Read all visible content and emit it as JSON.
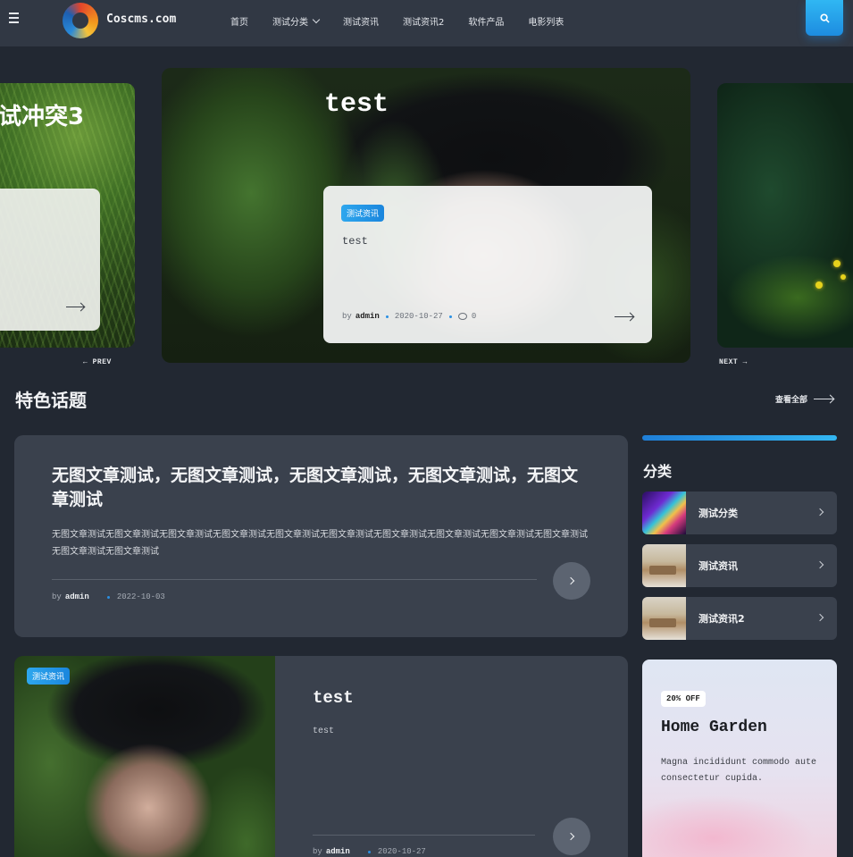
{
  "header": {
    "logo_text": "Coscms.com",
    "nav": [
      "首页",
      "测试分类",
      "测试资讯",
      "测试资讯2",
      "软件产品",
      "电影列表"
    ],
    "icons": [
      "menu-icon",
      "search-icon",
      "chevron-down-icon"
    ],
    "accent_color": "#1d8ce0"
  },
  "slider": {
    "left_title": "试冲突3",
    "main": {
      "title": "test",
      "badge": "测试资讯",
      "excerpt": "test",
      "by": "by",
      "author": "admin",
      "date": "2020-10-27",
      "comments": "0"
    },
    "prev_label": "PREV",
    "next_label": "NEXT"
  },
  "featured": {
    "title": "特色话题",
    "view_all": "查看全部",
    "post1": {
      "title": "无图文章测试，无图文章测试，无图文章测试，无图文章测试，无图文章测试",
      "excerpt": "无图文章测试无图文章测试无图文章测试无图文章测试无图文章测试无图文章测试无图文章测试无图文章测试无图文章测试无图文章测试无图文章测试无图文章测试",
      "by": "by",
      "author": "admin",
      "date": "2022-10-03"
    },
    "post2": {
      "badge": "测试资讯",
      "title": "test",
      "excerpt": "test",
      "by": "by",
      "author": "admin",
      "date": "2020-10-27"
    }
  },
  "sidebar": {
    "title": "分类",
    "categories": [
      "测试分类",
      "测试资讯",
      "测试资讯2"
    ],
    "promo": {
      "badge": "20% OFF",
      "title": "Home Garden",
      "text": "Magna incididunt commodo aute consectetur cupida."
    }
  }
}
